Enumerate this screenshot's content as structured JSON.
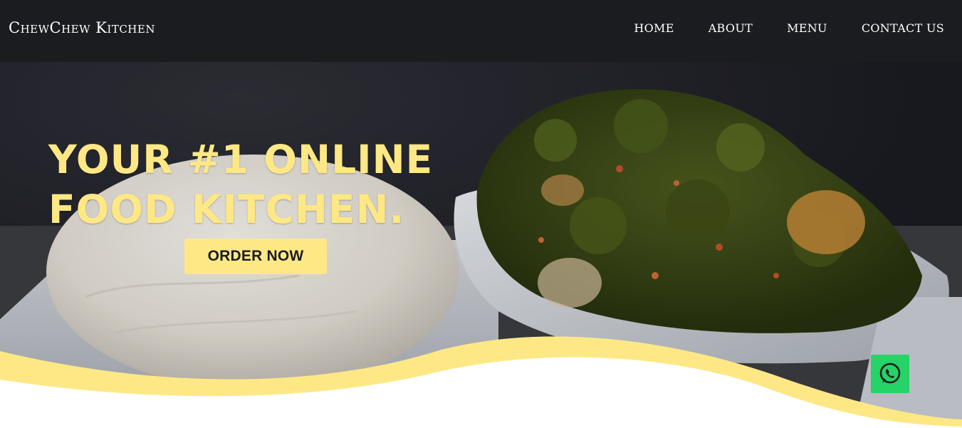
{
  "brand": {
    "name": "ChewChew Kitchen"
  },
  "nav": {
    "items": [
      {
        "label": "HOME"
      },
      {
        "label": "ABOUT"
      },
      {
        "label": "MENU"
      },
      {
        "label": "CONTACT US"
      }
    ]
  },
  "hero": {
    "headline_line1": "YOUR #1 ONLINE",
    "headline_line2": "FOOD KITCHEN.",
    "cta_label": "ORDER NOW",
    "image_subject": "pounded yam with vegetable soup"
  },
  "floating": {
    "whatsapp_icon": "whatsapp-icon"
  },
  "colors": {
    "navbar_bg": "#1b1c20",
    "accent_yellow": "#fde885",
    "whatsapp_green": "#25d366",
    "text_dark": "#1b1c20"
  }
}
